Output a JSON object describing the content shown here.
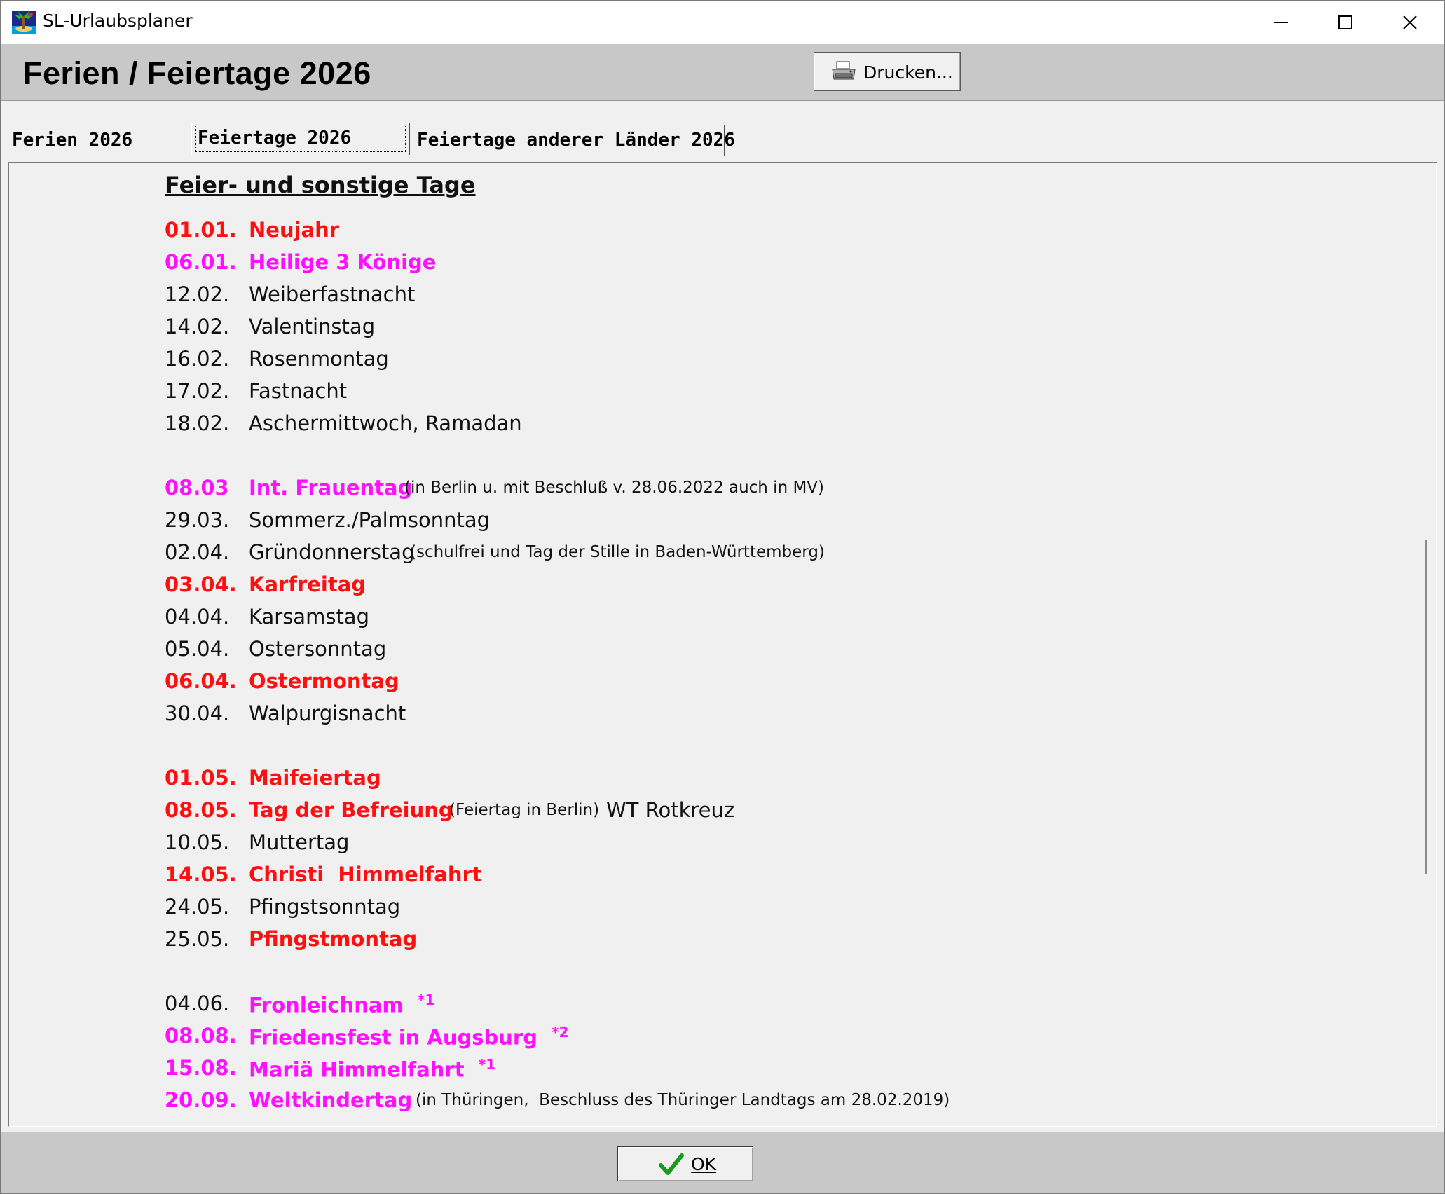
{
  "window": {
    "title": "SL-Urlaubsplaner",
    "icon": "palm-island-icon"
  },
  "header": {
    "title": "Ferien / Feiertage 2026",
    "print_label": "Drucken..."
  },
  "tabs": [
    {
      "label": "Ferien 2026",
      "active": false
    },
    {
      "label": "Feiertage 2026",
      "active": true
    },
    {
      "label": "Feiertage anderer Länder 2026",
      "active": false
    }
  ],
  "content": {
    "heading": "Feier- und sonstige Tage",
    "entries": [
      {
        "date": "01.01.",
        "name": "Neujahr",
        "style": "red"
      },
      {
        "date": "06.01.",
        "name": "Heilige 3 Könige",
        "style": "magenta"
      },
      {
        "date": "12.02.",
        "name": "Weiberfastnacht",
        "style": "plain"
      },
      {
        "date": "14.02.",
        "name": "Valentinstag",
        "style": "plain"
      },
      {
        "date": "16.02.",
        "name": "Rosenmontag",
        "style": "plain"
      },
      {
        "date": "17.02.",
        "name": "Fastnacht",
        "style": "plain"
      },
      {
        "date": "18.02.",
        "name": "Aschermittwoch, Ramadan",
        "style": "plain"
      },
      {
        "date": "08.03",
        "name": "Int. Frauentag",
        "note": "(in Berlin u. mit Beschluß v. 28.06.2022 auch in MV)",
        "style": "magenta"
      },
      {
        "date": "29.03.",
        "name": "Sommerz./Palmsonntag",
        "style": "plain"
      },
      {
        "date": "02.04.",
        "name": "Gründonnerstag",
        "note": "(schulfrei und Tag der Stille in Baden-Württemberg)",
        "style": "plain"
      },
      {
        "date": "03.04.",
        "name": "Karfreitag",
        "style": "red"
      },
      {
        "date": "04.04.",
        "name": "Karsamstag",
        "style": "plain"
      },
      {
        "date": "05.04.",
        "name": "Ostersonntag",
        "style": "plain"
      },
      {
        "date": "06.04.",
        "name": "Ostermontag",
        "style": "red"
      },
      {
        "date": "30.04.",
        "name": "Walpurgisnacht",
        "style": "plain"
      },
      {
        "date": "01.05.",
        "name": "Maifeiertag",
        "style": "red"
      },
      {
        "date": "08.05.",
        "name": "Tag der Befreiung",
        "note": "(Feiertag in Berlin)",
        "extra": "WT Rotkreuz",
        "style": "red"
      },
      {
        "date": "10.05.",
        "name": "Muttertag",
        "style": "plain"
      },
      {
        "date": "14.05.",
        "name": "Christi  Himmelfahrt",
        "style": "red"
      },
      {
        "date": "24.05.",
        "name": "Pfingstsonntag",
        "style": "plain"
      },
      {
        "date": "25.05.",
        "name": "Pfingstmontag",
        "style": "red_name"
      },
      {
        "date": "04.06.",
        "name": "Fronleichnam",
        "marker": "*1",
        "style": "magenta_name"
      },
      {
        "date": "08.08.",
        "name": "Friedensfest in Augsburg",
        "marker": "*2",
        "style": "magenta"
      },
      {
        "date": "15.08.",
        "name": "Mariä Himmelfahrt",
        "marker": "*1",
        "style": "magenta"
      },
      {
        "date": "20.09.",
        "name": "Weltkindertag",
        "note": "(in Thüringen,  Beschluss des Thüringer Landtags am 28.02.2019)",
        "style": "magenta"
      }
    ]
  },
  "footer": {
    "ok_label": "OK"
  },
  "colors": {
    "holiday_red": "#ff1010",
    "regional_magenta": "#ff10ff",
    "band_gray": "#c8c8c8"
  }
}
